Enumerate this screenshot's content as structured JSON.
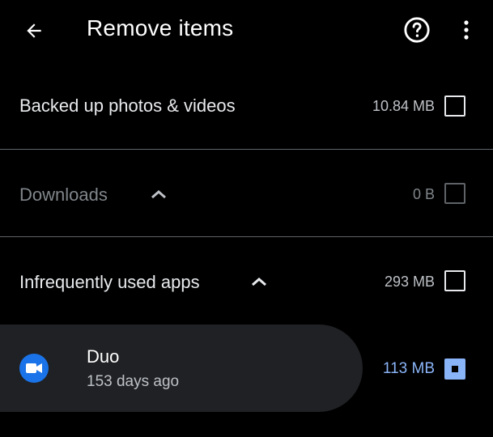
{
  "header": {
    "title": "Remove items",
    "back_icon": "arrow-back-icon",
    "help_icon": "help-circle-icon",
    "more_icon": "more-vert-icon"
  },
  "sections": [
    {
      "label": "Backed up photos & videos",
      "size": "10.84 MB",
      "checked": false,
      "disabled": false
    },
    {
      "label": "Downloads",
      "size": "0 B",
      "checked": false,
      "disabled": true,
      "expand_icon": "chevron-up-icon"
    },
    {
      "label": "Infrequently used apps",
      "size": "293 MB",
      "checked": false,
      "disabled": false,
      "expand_icon": "chevron-up-icon"
    }
  ],
  "apps": [
    {
      "name": "Duo",
      "subtitle": "153 days ago",
      "size": "113 MB",
      "checked": true,
      "icon": "duo-video-icon"
    }
  ],
  "colors": {
    "background": "#000000",
    "accent": "#8ab4f8",
    "app_icon": "#1a73e8",
    "card": "#202124",
    "divider": "#5f6368"
  }
}
